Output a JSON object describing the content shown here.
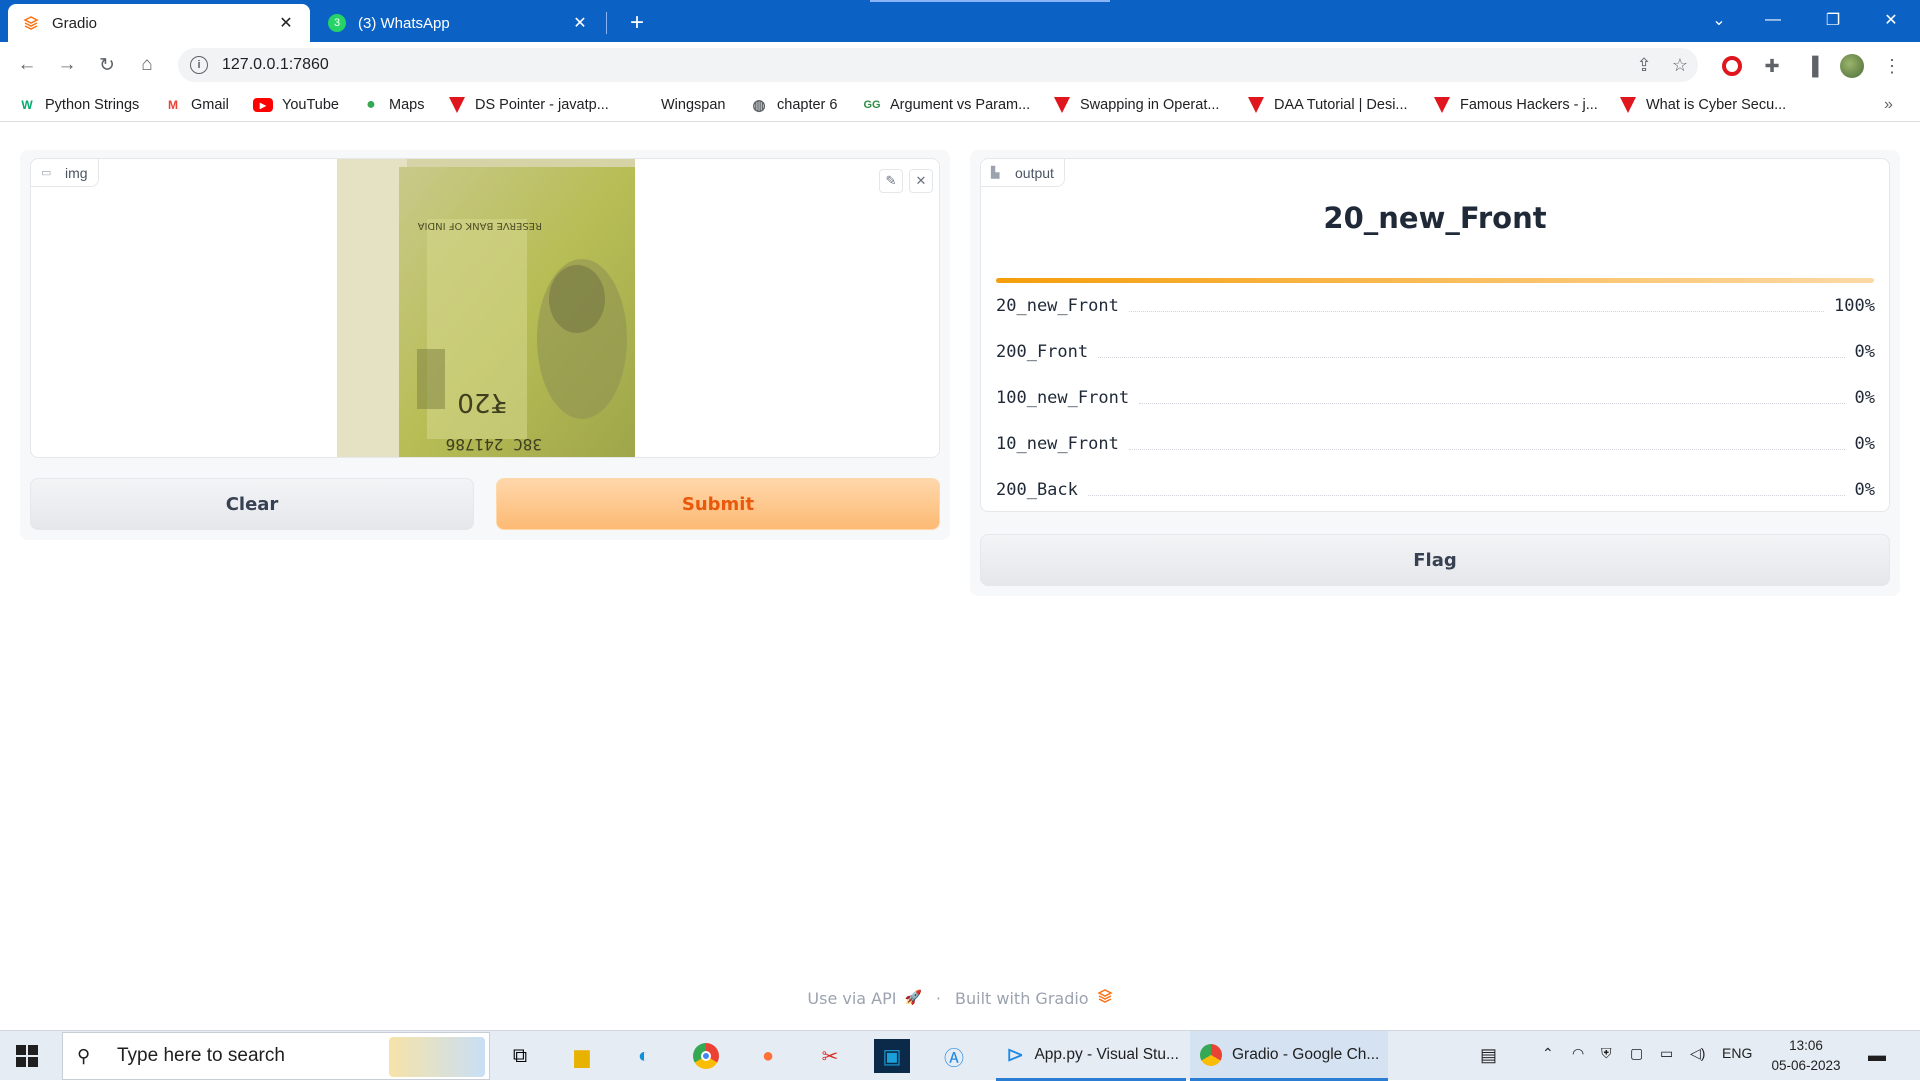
{
  "browser": {
    "tabs": [
      {
        "title": "Gradio",
        "active": true
      },
      {
        "title": "(3) WhatsApp",
        "active": false
      }
    ],
    "url": "127.0.0.1:7860",
    "bookmarks": [
      {
        "label": "Python Strings",
        "icon": "w3schools-icon"
      },
      {
        "label": "Gmail",
        "icon": "gmail-icon"
      },
      {
        "label": "YouTube",
        "icon": "youtube-icon"
      },
      {
        "label": "Maps",
        "icon": "maps-pin-icon"
      },
      {
        "label": "DS Pointer - javatp...",
        "icon": "javatpoint-icon"
      },
      {
        "label": "Wingspan",
        "icon": "blank-page-icon"
      },
      {
        "label": "chapter 6",
        "icon": "globe-icon"
      },
      {
        "label": "Argument vs Param...",
        "icon": "geeksforgeeks-icon"
      },
      {
        "label": "Swapping in Operat...",
        "icon": "javatpoint-icon"
      },
      {
        "label": "DAA Tutorial | Desi...",
        "icon": "javatpoint-icon"
      },
      {
        "label": "Famous Hackers - j...",
        "icon": "javatpoint-icon"
      },
      {
        "label": "What is Cyber Secu...",
        "icon": "javatpoint-icon"
      }
    ],
    "whatsapp_badge": "3"
  },
  "app": {
    "input_label": "img",
    "output_label": "output",
    "clear_label": "Clear",
    "submit_label": "Submit",
    "flag_label": "Flag",
    "top_prediction": "20_new_Front",
    "top_confidence": 1.0,
    "confidences": [
      {
        "label": "20_new_Front",
        "value": "100%"
      },
      {
        "label": "200_Front",
        "value": "0%"
      },
      {
        "label": "100_new_Front",
        "value": "0%"
      },
      {
        "label": "10_new_Front",
        "value": "0%"
      },
      {
        "label": "200_Back",
        "value": "0%"
      }
    ],
    "footer": {
      "api": "Use via API",
      "separator": "·",
      "built": "Built with Gradio"
    },
    "accent_color": "#f97316"
  },
  "taskbar": {
    "search_placeholder": "Type here to search",
    "apps": [
      {
        "label": "App.py - Visual Stu...",
        "icon": "vscode-icon"
      },
      {
        "label": "Gradio - Google Ch...",
        "icon": "chrome-icon"
      }
    ],
    "language": "ENG",
    "time": "13:06",
    "date": "05-06-2023"
  }
}
